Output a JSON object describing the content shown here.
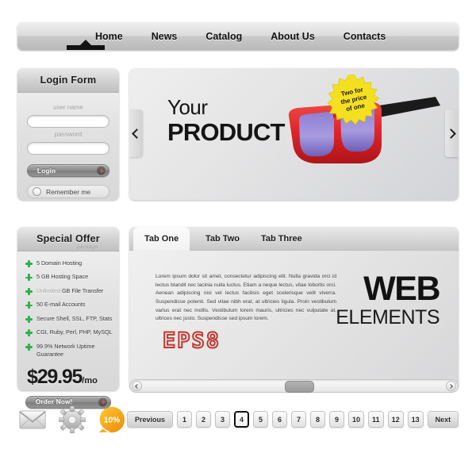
{
  "nav": {
    "items": [
      {
        "label": "Home",
        "active": true
      },
      {
        "label": "News",
        "active": false
      },
      {
        "label": "Catalog",
        "active": false
      },
      {
        "label": "About Us",
        "active": false
      },
      {
        "label": "Contacts",
        "active": false
      }
    ]
  },
  "login": {
    "title": "Login Form",
    "username_placeholder": "",
    "username_label": "user name",
    "username_value": "",
    "password_label": "password",
    "password_placeholder": "",
    "password_value": "",
    "submit_label": "Login",
    "remember_label": "Remember me"
  },
  "banner": {
    "line1": "Your",
    "line2": "PRODUCT",
    "badge_line1": "Two for",
    "badge_line2": "the price",
    "badge_line3": "of one",
    "badge_color": "#f5e020",
    "product_color": "#e0262b",
    "prev_icon": "chevron-left-icon",
    "next_icon": "chevron-right-icon"
  },
  "offer": {
    "title": "Special Offer",
    "subtitle": "package",
    "features": [
      {
        "muted": "",
        "text": "5 Domain Hosting"
      },
      {
        "muted": "",
        "text": "5 GB Hosting Space"
      },
      {
        "muted": "Unlimited",
        "text": " GB File Transfer"
      },
      {
        "muted": "",
        "text": "50 E-mail Accounts"
      },
      {
        "muted": "",
        "text": "Secure Shell, SSL, FTP, Stats"
      },
      {
        "muted": "",
        "text": "CGI, Ruby, Perl, PHP, MySQL"
      },
      {
        "muted": "",
        "text": "99.9% Network Uptime Guarantee"
      }
    ],
    "price": "$29.95",
    "price_period": "/mo",
    "order_label": "Order Now!"
  },
  "tabs": {
    "items": [
      {
        "label": "Tab One",
        "active": true
      },
      {
        "label": "Tab Two",
        "active": false
      },
      {
        "label": "Tab Three",
        "active": false
      }
    ],
    "body_text": "Lorem ipsum dolor sit amet, consectetur adipiscing elit. Nulla gravida orci id lectus blandit nec lacinia nulla luctus. Etiam a neque lectus, vitae lobortis orci. Aenean adipiscing nisi vel lectus facilisis eget scelerisque velit viverra. Suspendisse potenti. Sed vitae nibh erat, at ultricies ligula. Proin vestibulum varius erat nec mollis. Vestibulum lorem mauris, ultricies nec vulputate at, ultrices nec justo. Suspendisse sed ipsum lorem.",
    "eps_label": "EPS8",
    "eps_color": "#c0392f",
    "headline_big": "WEB",
    "headline_small": "ELEMENTS"
  },
  "scrollbar": {
    "left_icon": "arrow-left-icon",
    "right_icon": "arrow-right-icon"
  },
  "footer": {
    "icons": [
      {
        "name": "envelope-icon"
      },
      {
        "name": "gear-icon"
      },
      {
        "name": "discount-badge-icon"
      }
    ],
    "discount_label": "10%",
    "discount_color": "#f5a623"
  },
  "pagination": {
    "previous_label": "Previous",
    "next_label": "Next",
    "pages": [
      "1",
      "2",
      "3",
      "4",
      "5",
      "6",
      "7",
      "8",
      "9",
      "10",
      "11",
      "12",
      "13"
    ],
    "current_page": "4"
  }
}
